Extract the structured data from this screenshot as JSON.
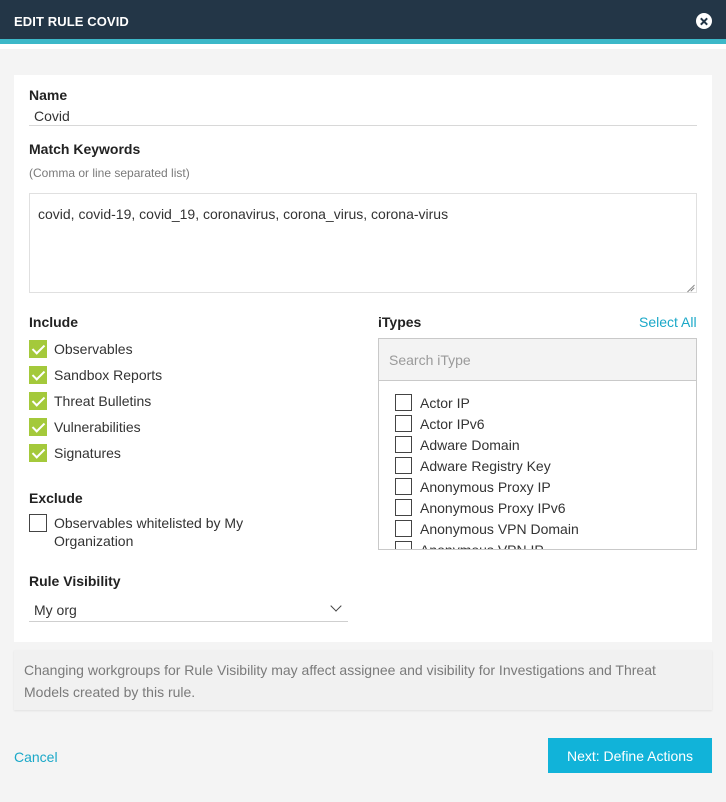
{
  "header": {
    "title": "EDIT RULE COVID"
  },
  "name": {
    "label": "Name",
    "value": "Covid"
  },
  "keywords": {
    "label": "Match Keywords",
    "hint": "(Comma or line separated list)",
    "value": "covid, covid-19, covid_19, coronavirus, corona_virus, corona-virus"
  },
  "include": {
    "label": "Include",
    "items": [
      {
        "label": "Observables",
        "checked": true
      },
      {
        "label": "Sandbox Reports",
        "checked": true
      },
      {
        "label": "Threat Bulletins",
        "checked": true
      },
      {
        "label": "Vulnerabilities",
        "checked": true
      },
      {
        "label": "Signatures",
        "checked": true
      }
    ]
  },
  "exclude": {
    "label": "Exclude",
    "item": {
      "label": "Observables whitelisted by My Organization",
      "checked": false
    }
  },
  "itypes": {
    "label": "iTypes",
    "select_all": "Select All",
    "search_placeholder": "Search iType",
    "items": [
      {
        "label": "Actor IP",
        "checked": false
      },
      {
        "label": "Actor IPv6",
        "checked": false
      },
      {
        "label": "Adware Domain",
        "checked": false
      },
      {
        "label": "Adware Registry Key",
        "checked": false
      },
      {
        "label": "Anonymous Proxy IP",
        "checked": false
      },
      {
        "label": "Anonymous Proxy IPv6",
        "checked": false
      },
      {
        "label": "Anonymous VPN Domain",
        "checked": false
      },
      {
        "label": "Anonymous VPN IP",
        "checked": false
      }
    ]
  },
  "visibility": {
    "label": "Rule Visibility",
    "value": "My org"
  },
  "notice": "Changing workgroups for Rule Visibility may affect assignee and visibility for Investigations and Threat Models created by this rule.",
  "footer": {
    "cancel": "Cancel",
    "next": "Next: Define Actions"
  },
  "colors": {
    "header_bg": "#233647",
    "header_accent": "#3cb8c8",
    "checkbox_checked": "#a4c93b",
    "link": "#1aa8c8",
    "primary_button": "#11b3d9"
  }
}
